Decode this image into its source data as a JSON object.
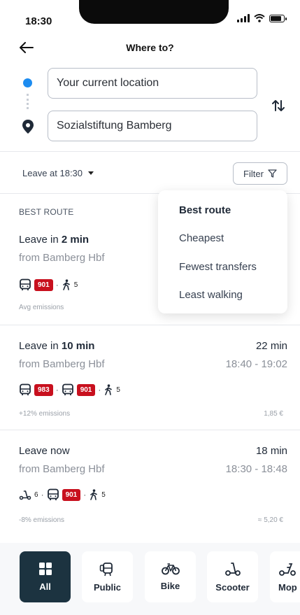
{
  "status": {
    "time": "18:30"
  },
  "header": {
    "title": "Where to?"
  },
  "search": {
    "origin_value": "Your current location",
    "destination_value": "Sozialstiftung Bamberg"
  },
  "controls": {
    "leave_at": "Leave at 18:30",
    "filter_label": "Filter"
  },
  "dropdown": {
    "items": [
      {
        "label": "Best route",
        "selected": true
      },
      {
        "label": "Cheapest"
      },
      {
        "label": "Fewest transfers"
      },
      {
        "label": "Least walking"
      }
    ]
  },
  "routes": [
    {
      "label": "BEST ROUTE",
      "leave_prefix": "Leave in ",
      "leave_bold": "2 min",
      "from": "from Bamberg Hbf",
      "legs": [
        {
          "type": "bus",
          "icon": "bus-icon",
          "line": "901"
        },
        {
          "type": "walk",
          "icon": "walk-icon",
          "count": "5"
        }
      ],
      "emissions": "Avg emissions"
    },
    {
      "leave_prefix": "Leave in ",
      "leave_bold": "10 min",
      "from": "from Bamberg Hbf",
      "duration": "22 min",
      "times": "18:40 - 19:02",
      "legs": [
        {
          "type": "bus",
          "icon": "bus-icon",
          "line": "983"
        },
        {
          "type": "bus",
          "icon": "bus-icon",
          "line": "901"
        },
        {
          "type": "walk",
          "icon": "walk-icon",
          "count": "5"
        }
      ],
      "emissions": "+12% emissions",
      "price": "1,85 €"
    },
    {
      "leave_prefix": "Leave now",
      "from": "from Bamberg Hbf",
      "duration": "18 min",
      "times": "18:30 - 18:48",
      "legs": [
        {
          "type": "scooter",
          "icon": "scooter-icon",
          "count": "6"
        },
        {
          "type": "bus",
          "icon": "bus-icon",
          "line": "901"
        },
        {
          "type": "walk",
          "icon": "walk-icon",
          "count": "5"
        }
      ],
      "emissions": "-8% emissions",
      "price": "≈ 5,20 €"
    }
  ],
  "modes": [
    {
      "label": "All",
      "icon": "grid-icon",
      "active": true
    },
    {
      "label": "Public",
      "icon": "tram-icon"
    },
    {
      "label": "Bike",
      "icon": "bike-icon"
    },
    {
      "label": "Scooter",
      "icon": "scooter-icon"
    },
    {
      "label": "Mop",
      "icon": "moped-icon"
    }
  ],
  "colors": {
    "accent": "#1d8cf0",
    "line_badge": "#c8101e",
    "active_mode": "#1c3340"
  }
}
